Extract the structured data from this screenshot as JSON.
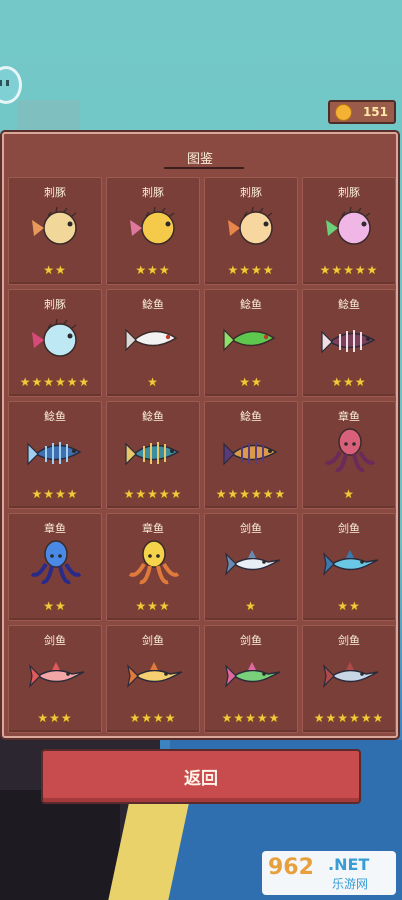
{
  "hud": {
    "coins": "151",
    "coin_icon": "coin-icon"
  },
  "panel": {
    "title": "图鉴"
  },
  "cards": [
    {
      "name": "刺豚",
      "stars": "★★",
      "kind": "puffer",
      "body": "#f2d79a",
      "accent": "#e79a5a"
    },
    {
      "name": "刺豚",
      "stars": "★★★",
      "kind": "puffer",
      "body": "#f5c94a",
      "accent": "#e0789e"
    },
    {
      "name": "刺豚",
      "stars": "★★★★",
      "kind": "puffer",
      "body": "#f7d6a0",
      "accent": "#e8874a"
    },
    {
      "name": "刺豚",
      "stars": "★★★★★",
      "kind": "puffer",
      "body": "#f0b6e6",
      "accent": "#6ad07a"
    },
    {
      "name": "刺豚",
      "stars": "★★★★★★",
      "kind": "puffer",
      "body": "#bfe8f5",
      "accent": "#d94a7a"
    },
    {
      "name": "鲶鱼",
      "stars": "★",
      "kind": "fish",
      "body": "#f2f2f2",
      "accent": "#d9d9d9"
    },
    {
      "name": "鲶鱼",
      "stars": "★★",
      "kind": "fish",
      "body": "#5ec84e",
      "accent": "#8fe06a"
    },
    {
      "name": "鲶鱼",
      "stars": "★★★",
      "kind": "bone",
      "body": "#7a3f5a",
      "accent": "#f0e0e6"
    },
    {
      "name": "鲶鱼",
      "stars": "★★★★",
      "kind": "bone",
      "body": "#3f6fb0",
      "accent": "#9fd0f0"
    },
    {
      "name": "鲶鱼",
      "stars": "★★★★★",
      "kind": "bone",
      "body": "#3d8fa0",
      "accent": "#e6c86a"
    },
    {
      "name": "鲶鱼",
      "stars": "★★★★★★",
      "kind": "bone",
      "body": "#d99a4a",
      "accent": "#5a3a7a"
    },
    {
      "name": "章鱼",
      "stars": "★",
      "kind": "octopus",
      "body": "#d9607a",
      "accent": "#6a2a5a"
    },
    {
      "name": "章鱼",
      "stars": "★★",
      "kind": "octopus",
      "body": "#4a8ae6",
      "accent": "#2a2a8a"
    },
    {
      "name": "章鱼",
      "stars": "★★★",
      "kind": "octopus",
      "body": "#f5d34a",
      "accent": "#e07a3a"
    },
    {
      "name": "剑鱼",
      "stars": "★",
      "kind": "sword",
      "body": "#e8eef5",
      "accent": "#6a8ab0"
    },
    {
      "name": "剑鱼",
      "stars": "★★",
      "kind": "sword",
      "body": "#6ac8e6",
      "accent": "#3a7ab0"
    },
    {
      "name": "剑鱼",
      "stars": "★★★",
      "kind": "sword",
      "body": "#f2a6a6",
      "accent": "#e05a5a"
    },
    {
      "name": "剑鱼",
      "stars": "★★★★",
      "kind": "sword",
      "body": "#f5d070",
      "accent": "#e07a3a"
    },
    {
      "name": "剑鱼",
      "stars": "★★★★★",
      "kind": "sword",
      "body": "#7ad07a",
      "accent": "#e06aa0"
    },
    {
      "name": "剑鱼",
      "stars": "★★★★★★",
      "kind": "sword",
      "body": "#c9d6e6",
      "accent": "#b04a4a"
    }
  ],
  "buttons": {
    "back": "返回"
  },
  "watermark": {
    "num": "962",
    "net": ".NET",
    "cn": "乐游网"
  }
}
